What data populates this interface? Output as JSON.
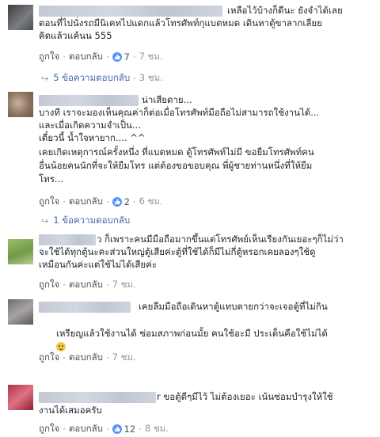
{
  "comments": [
    {
      "lines": [
        "เหลือไว้บ้างก็ดีนะ ยังจำได้เลย",
        "ตอนที่ไปนั่งรถมีนิเคทไปแดกแล้วโทรศัพท์กุแบตหมด เดินหาตู้ขาลากเลียย",
        "คิดแล้วแค้นน 555"
      ],
      "like": "ถูกใจ",
      "reply": "ตอบกลับ",
      "reactions": "7",
      "time": "7 ชม.",
      "replies_label": "5 ข้อความตอบกลับ",
      "replies_time": "3 ชม."
    },
    {
      "lines": [
        "น่าเสียดาย...",
        "บางที เราจะมองเห็นคุณค่าก็ต่อเมื่อโทรศัพท์มือถือไม่สามารถใช้งานได้...",
        "และเมื่อเกิดความจำเป็น...",
        "เดี๋ยวนี้ น้ำใจหายาก.... ^^",
        "เคยเกิดเหตุการณ์ครั้งหนึ่ง ที่แบตหมด ตู้โทรศัพท์ไม่มี ขอยืมโทรศัพท์คน",
        "อื่นน้อยคนนักที่จะให้ยืมโทร แต่ต้องขอขอบคุณ พี่ผู้ชายท่านหนึ่งที่ให้ยืม",
        "โทร..."
      ],
      "like": "ถูกใจ",
      "reply": "ตอบกลับ",
      "reactions": "2",
      "time": "6 ชม.",
      "replies_label": "1 ข้อความตอบกลับ",
      "replies_time": ""
    },
    {
      "lines": [
        "ว ก็เพราะคนมีมือถือมากขึ้นแต่โทรศัพย์เห็นเรียงกันเยอะๆก็ไม่ว่า",
        "จะใช้ได้ทุกตู้นะคะส่วนใหญ่ตู้เสียค่ะตู้ที่ใช้ได้ก็มีไม่กี่ตู้หรอกเคยลองๆใช้ดู",
        "เหมือนกันค่ะแต่ใช้ไม่ได้เสียค่ะ"
      ],
      "like": "ถูกใจ",
      "reply": "ตอบกลับ",
      "reactions": "",
      "time": "7 ชม."
    },
    {
      "lines": [
        "เคยลืมมือถือเดินหาตู้แทบตายกว่าจะเจอตู้ที่ไม่กิน",
        "เหรียญแล้วใช้งานได้ ซ่อมสภาพก่อนมั้ย คนใช้อะมี ประเด็นคือใช้ไม่ได้"
      ],
      "like": "ถูกใจ",
      "reply": "ตอบกลับ",
      "reactions": "",
      "time": "7 ชม."
    },
    {
      "lines": [
        "r ขอตู้ดีๆมีไว้ ไม่ต้องเยอะ เน้นซ่อมบำรุงให้ใช้",
        "งานได้เสมอครับ"
      ],
      "like": "ถูกใจ",
      "reply": "ตอบกลับ",
      "reactions": "12",
      "time": "8 ชม."
    }
  ],
  "colors": {
    "link": "#4267b2",
    "meta": "#90949c",
    "like_bubble": "#5890ff"
  }
}
